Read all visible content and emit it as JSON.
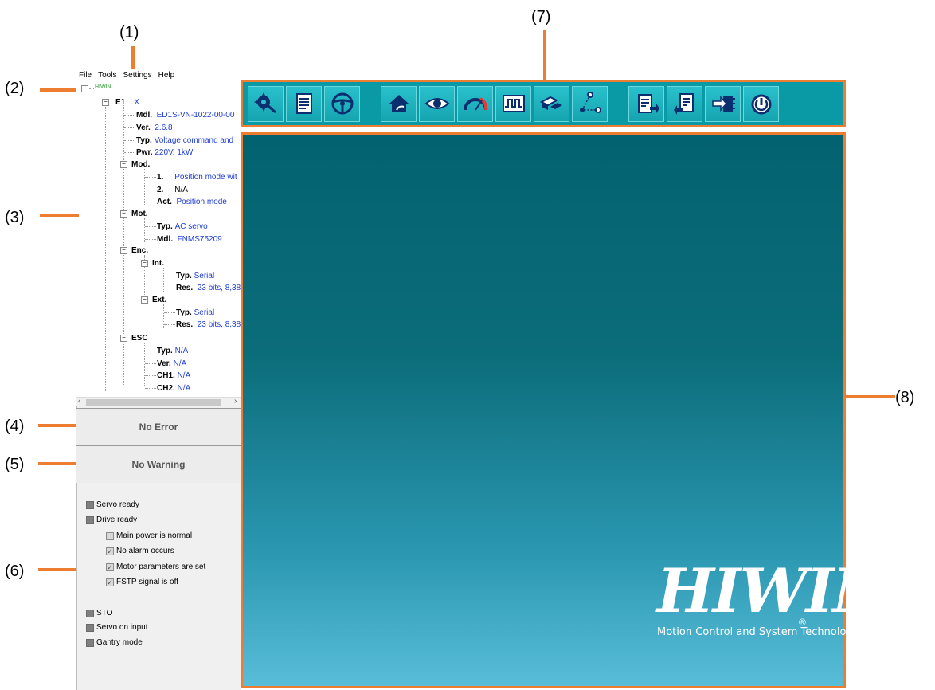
{
  "callouts": {
    "c1": "(1)",
    "c2": "(2)",
    "c3": "(3)",
    "c4": "(4)",
    "c5": "(5)",
    "c6": "(6)",
    "c7": "(7)",
    "c8": "(8)"
  },
  "menu": {
    "file": "File",
    "tools": "Tools",
    "settings": "Settings",
    "help": "Help"
  },
  "tree": {
    "root": "HIWIN",
    "e1": {
      "key": "E1",
      "value": "X"
    },
    "mdl": {
      "key": "Mdl.",
      "value": "ED1S-VN-1022-00-00"
    },
    "ver": {
      "key": "Ver.",
      "value": "2.6.8"
    },
    "typ": {
      "key": "Typ.",
      "value": "Voltage command and"
    },
    "pwr": {
      "key": "Pwr.",
      "value": "220V, 1kW"
    },
    "mod": {
      "key": "Mod.",
      "m1": {
        "key": "1.",
        "value": "Position mode wit"
      },
      "m2": {
        "key": "2.",
        "value": "N/A"
      },
      "act": {
        "key": "Act.",
        "value": "Position mode"
      }
    },
    "mot": {
      "key": "Mot.",
      "typ": {
        "key": "Typ.",
        "value": "AC servo"
      },
      "mdl": {
        "key": "Mdl.",
        "value": "FNMS75209"
      }
    },
    "enc": {
      "key": "Enc.",
      "int": {
        "key": "Int.",
        "typ": {
          "key": "Typ.",
          "value": "Serial"
        },
        "res": {
          "key": "Res.",
          "value": "23 bits, 8,38"
        }
      },
      "ext": {
        "key": "Ext.",
        "typ": {
          "key": "Typ.",
          "value": "Serial"
        },
        "res": {
          "key": "Res.",
          "value": "23 bits, 8,38"
        }
      }
    },
    "esc": {
      "key": "ESC",
      "typ": {
        "key": "Typ.",
        "value": "N/A"
      },
      "ver": {
        "key": "Ver.",
        "value": "N/A"
      },
      "ch1": {
        "key": "CH1.",
        "value": "N/A"
      },
      "ch2": {
        "key": "CH2.",
        "value": "N/A"
      }
    }
  },
  "status": {
    "error": "No Error",
    "warning": "No Warning"
  },
  "indicators": {
    "servo_ready": "Servo ready",
    "drive_ready": "Drive ready",
    "main_power": "Main power is normal",
    "no_alarm": "No alarm occurs",
    "motor_params": "Motor parameters are set",
    "fstp": "FSTP signal is off",
    "sto": "STO",
    "servo_on_input": "Servo on input",
    "gantry_mode": "Gantry mode"
  },
  "toolbar_icons": [
    "configuration-icon",
    "parameters-icon",
    "steering-wheel-icon",
    "home-icon",
    "monitor-eye-icon",
    "gauge-icon",
    "scope-icon",
    "encoder-icon",
    "path-icon",
    "export-icon",
    "import-icon",
    "firmware-icon",
    "power-reset-icon"
  ],
  "logo": {
    "brand": "HIWIN",
    "registered": "®",
    "tagline": "Motion Control and System Technology"
  },
  "colors": {
    "accent": "#ed7d31",
    "toolbar": "#0a9aa6",
    "main_top": "#03626f",
    "main_bottom": "#58bdd8",
    "tree_value": "#1f3dd6"
  }
}
